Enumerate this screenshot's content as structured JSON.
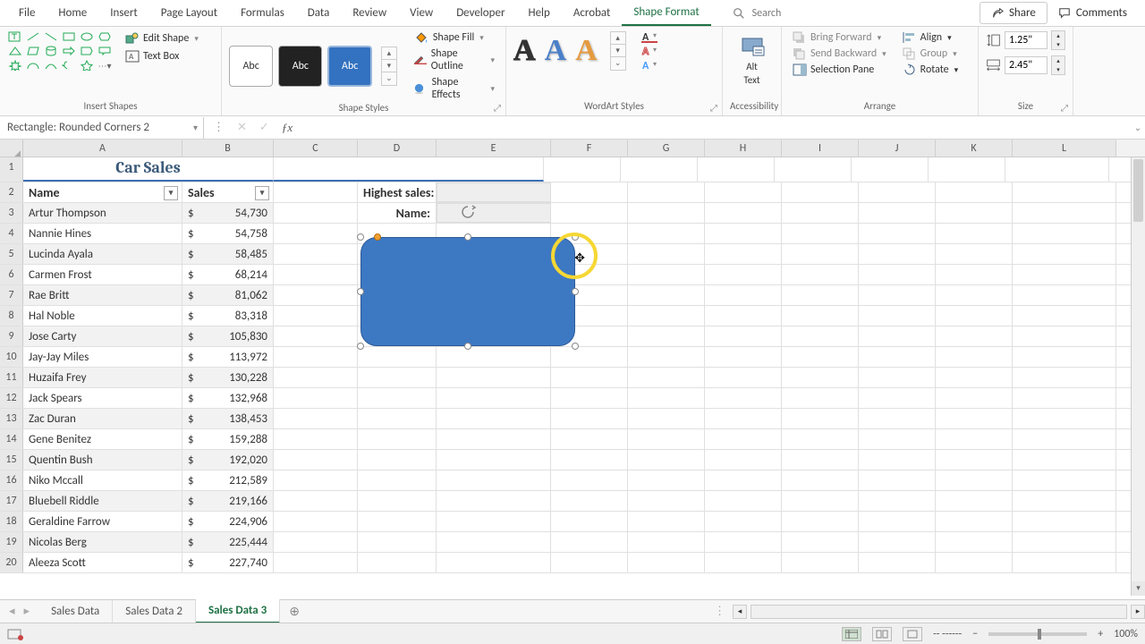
{
  "tabs": {
    "file": "File",
    "home": "Home",
    "insert": "Insert",
    "pageLayout": "Page Layout",
    "formulas": "Formulas",
    "data": "Data",
    "review": "Review",
    "view": "View",
    "developer": "Developer",
    "help": "Help",
    "acrobat": "Acrobat",
    "shapeFormat": "Shape Format"
  },
  "search_placeholder": "Search",
  "share": "Share",
  "comments": "Comments",
  "ribbon": {
    "insertShapes": {
      "label": "Insert Shapes",
      "editShape": "Edit Shape",
      "textBox": "Text Box"
    },
    "shapeStyles": {
      "label": "Shape Styles",
      "abc": "Abc",
      "fill": "Shape Fill",
      "outline": "Shape Outline",
      "effects": "Shape Effects"
    },
    "wordart": {
      "label": "WordArt Styles",
      "A": "A"
    },
    "accessibility": {
      "label": "Accessibility",
      "alt": "Alt",
      "text": "Text"
    },
    "arrange": {
      "label": "Arrange",
      "bringForward": "Bring Forward",
      "sendBackward": "Send Backward",
      "selectionPane": "Selection Pane",
      "align": "Align",
      "group": "Group",
      "rotate": "Rotate"
    },
    "size": {
      "label": "Size",
      "height": "1.25\"",
      "width": "2.45\""
    }
  },
  "namebox": "Rectangle: Rounded Corners 2",
  "cols": [
    "A",
    "B",
    "C",
    "D",
    "E",
    "F",
    "G",
    "H",
    "I",
    "J",
    "K",
    "L"
  ],
  "title": "Car Sales",
  "headers": {
    "name": "Name",
    "sales": "Sales",
    "highest": "Highest sales:",
    "hname": "Name:"
  },
  "rows": [
    {
      "n": 3,
      "name": "Artur Thompson",
      "s": "54,730"
    },
    {
      "n": 4,
      "name": "Nannie Hines",
      "s": "54,758"
    },
    {
      "n": 5,
      "name": "Lucinda Ayala",
      "s": "58,485"
    },
    {
      "n": 6,
      "name": "Carmen Frost",
      "s": "68,214"
    },
    {
      "n": 7,
      "name": "Rae Britt",
      "s": "81,062"
    },
    {
      "n": 8,
      "name": "Hal Noble",
      "s": "83,318"
    },
    {
      "n": 9,
      "name": "Jose Carty",
      "s": "105,830"
    },
    {
      "n": 10,
      "name": "Jay-Jay Miles",
      "s": "113,972"
    },
    {
      "n": 11,
      "name": "Huzaifa Frey",
      "s": "130,228"
    },
    {
      "n": 12,
      "name": "Jack Spears",
      "s": "132,968"
    },
    {
      "n": 13,
      "name": "Zac Duran",
      "s": "138,453"
    },
    {
      "n": 14,
      "name": "Gene Benitez",
      "s": "159,288"
    },
    {
      "n": 15,
      "name": "Quentin Bush",
      "s": "192,020"
    },
    {
      "n": 16,
      "name": "Niko Mccall",
      "s": "212,589"
    },
    {
      "n": 17,
      "name": "Bluebell Riddle",
      "s": "219,166"
    },
    {
      "n": 18,
      "name": "Geraldine Farrow",
      "s": "224,906"
    },
    {
      "n": 19,
      "name": "Nicolas Berg",
      "s": "225,444"
    },
    {
      "n": 20,
      "name": "Aleeza Scott",
      "s": "227,740"
    }
  ],
  "dollar": "$",
  "sheets": {
    "s1": "Sales Data",
    "s2": "Sales Data 2",
    "s3": "Sales Data 3"
  },
  "zoom": "100%",
  "status_dash": "-- ------"
}
